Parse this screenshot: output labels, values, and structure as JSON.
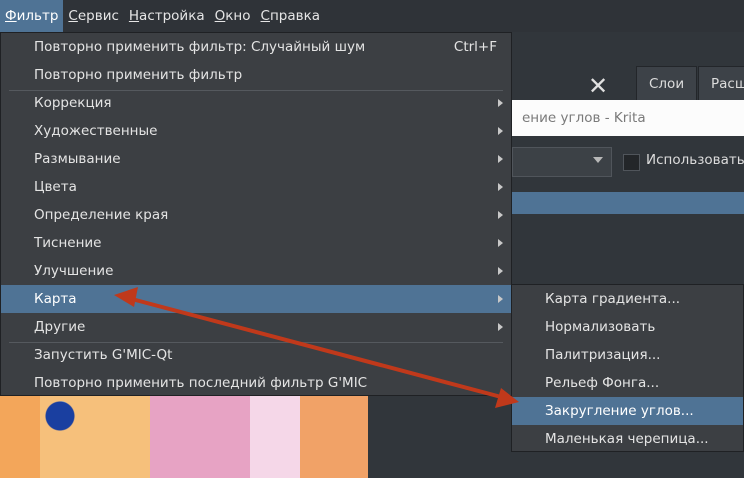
{
  "menubar": {
    "items": [
      {
        "label": "Фильтр",
        "active": true
      },
      {
        "label": "Сервис",
        "active": false
      },
      {
        "label": "Настройка",
        "active": false
      },
      {
        "label": "Окно",
        "active": false
      },
      {
        "label": "Справка",
        "active": false
      }
    ]
  },
  "background": {
    "close_glyph": "✕",
    "dock_tabs": [
      "Слои",
      "Расш"
    ],
    "window_title": "ение углов - Krita",
    "checkbox_label": "Использовать"
  },
  "filter_menu": {
    "items": [
      {
        "label": "Повторно применить фильтр: Случайный шум",
        "shortcut": "Ctrl+F",
        "submenu": false
      },
      {
        "label": "Повторно применить фильтр",
        "submenu": false
      },
      {
        "label": "Коррекция",
        "submenu": true
      },
      {
        "label": "Художественные",
        "submenu": true
      },
      {
        "label": "Размывание",
        "submenu": true
      },
      {
        "label": "Цвета",
        "submenu": true
      },
      {
        "label": "Определение края",
        "submenu": true
      },
      {
        "label": "Тиснение",
        "submenu": true
      },
      {
        "label": "Улучшение",
        "submenu": true
      },
      {
        "label": "Карта",
        "submenu": true,
        "highlighted": true
      },
      {
        "label": "Другие",
        "submenu": true
      },
      {
        "label": "Запустить G'MIC-Qt",
        "submenu": false
      },
      {
        "label": "Повторно применить последний фильтр G'MIC",
        "submenu": false
      }
    ]
  },
  "map_submenu": {
    "items": [
      {
        "label": "Карта градиента..."
      },
      {
        "label": "Нормализовать"
      },
      {
        "label": "Палитризация..."
      },
      {
        "label": "Рельеф Фонга..."
      },
      {
        "label": "Закругление углов...",
        "highlighted": true
      },
      {
        "label": "Маленькая черепица..."
      }
    ]
  },
  "colors": {
    "highlight": "#4f7395",
    "menu_bg": "#3c3f43",
    "annotation_arrow": "#c0391b"
  }
}
